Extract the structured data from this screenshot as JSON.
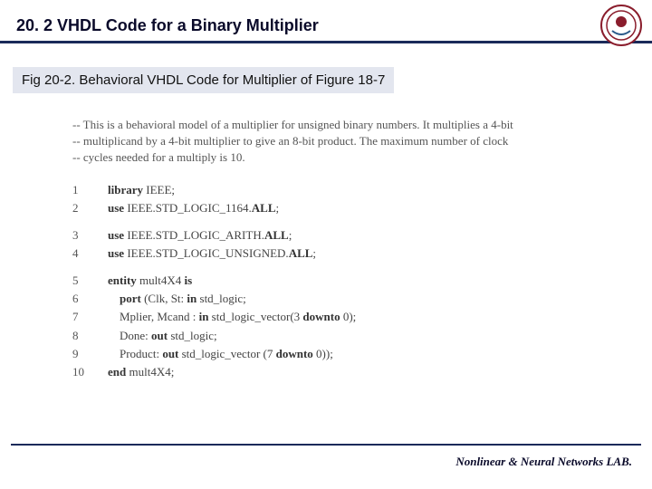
{
  "header": {
    "title": "20. 2 VHDL Code for a Binary Multiplier",
    "logo_name": "university-seal"
  },
  "subtitle": "Fig 20-2. Behavioral VHDL Code for Multiplier of Figure 18-7",
  "comment_lines": [
    "-- This is a behavioral model of a multiplier for unsigned binary numbers. It multiplies a 4-bit",
    "-- multiplicand by a 4-bit multiplier to give an 8-bit product. The maximum number of clock",
    "-- cycles needed for a multiply is 10."
  ],
  "code": [
    {
      "n": "1",
      "indent": 1,
      "parts": [
        {
          "b": true,
          "t": "library"
        },
        {
          "b": false,
          "t": " IEEE;"
        }
      ]
    },
    {
      "n": "2",
      "indent": 1,
      "parts": [
        {
          "b": true,
          "t": "use"
        },
        {
          "b": false,
          "t": " IEEE.STD_LOGIC_1164."
        },
        {
          "b": true,
          "t": "ALL"
        },
        {
          "b": false,
          "t": ";"
        }
      ]
    },
    {
      "spacer": true
    },
    {
      "n": "3",
      "indent": 1,
      "parts": [
        {
          "b": true,
          "t": "use"
        },
        {
          "b": false,
          "t": " IEEE.STD_LOGIC_ARITH."
        },
        {
          "b": true,
          "t": "ALL"
        },
        {
          "b": false,
          "t": ";"
        }
      ]
    },
    {
      "n": "4",
      "indent": 1,
      "parts": [
        {
          "b": true,
          "t": "use"
        },
        {
          "b": false,
          "t": " IEEE.STD_LOGIC_UNSIGNED."
        },
        {
          "b": true,
          "t": "ALL"
        },
        {
          "b": false,
          "t": ";"
        }
      ]
    },
    {
      "spacer": true
    },
    {
      "n": "5",
      "indent": 1,
      "parts": [
        {
          "b": true,
          "t": "entity"
        },
        {
          "b": false,
          "t": " mult4X4 "
        },
        {
          "b": true,
          "t": "is"
        }
      ]
    },
    {
      "n": "6",
      "indent": 2,
      "parts": [
        {
          "b": true,
          "t": "port"
        },
        {
          "b": false,
          "t": " (Clk, St: "
        },
        {
          "b": true,
          "t": "in"
        },
        {
          "b": false,
          "t": " std_logic;"
        }
      ]
    },
    {
      "n": "7",
      "indent": 2,
      "parts": [
        {
          "b": false,
          "t": "Mplier, Mcand : "
        },
        {
          "b": true,
          "t": "in"
        },
        {
          "b": false,
          "t": " std_logic_vector(3 "
        },
        {
          "b": true,
          "t": "downto"
        },
        {
          "b": false,
          "t": " 0);"
        }
      ]
    },
    {
      "n": "8",
      "indent": 2,
      "parts": [
        {
          "b": false,
          "t": "Done: "
        },
        {
          "b": true,
          "t": "out"
        },
        {
          "b": false,
          "t": " std_logic;"
        }
      ]
    },
    {
      "n": "9",
      "indent": 2,
      "parts": [
        {
          "b": false,
          "t": "Product: "
        },
        {
          "b": true,
          "t": "out"
        },
        {
          "b": false,
          "t": " std_logic_vector (7 "
        },
        {
          "b": true,
          "t": "downto"
        },
        {
          "b": false,
          "t": " 0));"
        }
      ]
    },
    {
      "n": "10",
      "indent": 1,
      "parts": [
        {
          "b": true,
          "t": "end"
        },
        {
          "b": false,
          "t": " mult4X4;"
        }
      ]
    }
  ],
  "footer": "Nonlinear & Neural Networks LAB."
}
